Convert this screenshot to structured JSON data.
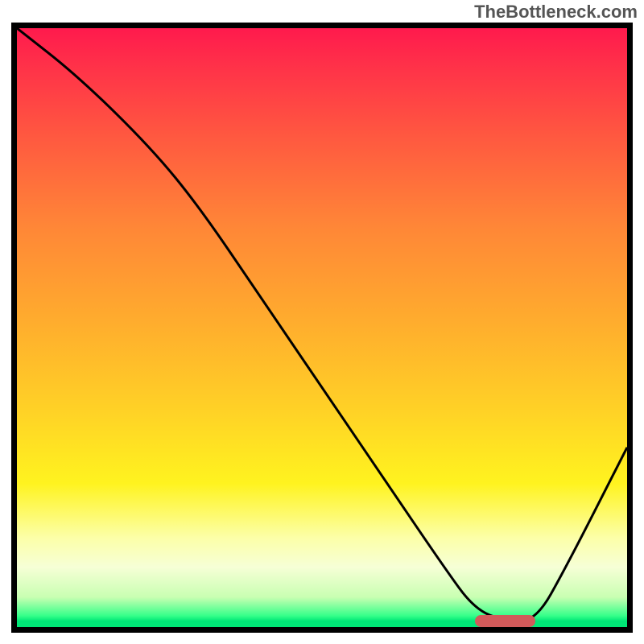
{
  "watermark": "TheBottleneck.com",
  "chart_data": {
    "type": "line",
    "title": "",
    "xlabel": "",
    "ylabel": "",
    "xlim": [
      0,
      100
    ],
    "ylim": [
      0,
      100
    ],
    "gradient_colors": {
      "top": "#ff1a4d",
      "mid_upper": "#ffaa2e",
      "mid_lower": "#fff31f",
      "bottom": "#00e676"
    },
    "series": [
      {
        "name": "bottleneck-curve",
        "color": "#000000",
        "x": [
          0,
          10,
          22,
          30,
          40,
          50,
          60,
          70,
          75,
          80,
          85,
          90,
          100
        ],
        "y": [
          100,
          92,
          80,
          70,
          55,
          40,
          25,
          10,
          3,
          1,
          1,
          10,
          30
        ]
      }
    ],
    "optimal_marker": {
      "x_start": 75,
      "x_end": 85,
      "y": 1,
      "color": "#d15a5a"
    },
    "annotations": []
  }
}
